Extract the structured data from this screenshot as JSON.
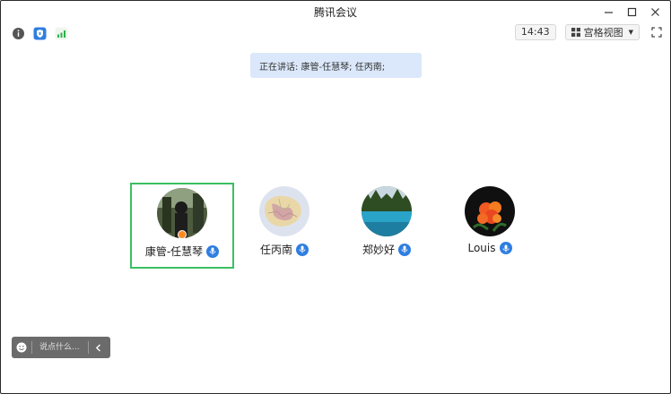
{
  "window": {
    "title": "腾讯会议"
  },
  "toolbar": {
    "time": "14:43",
    "view_label": "宫格视图"
  },
  "speaking": {
    "text": "正在讲话: 康管-任慧琴; 任丙南;"
  },
  "participants": [
    {
      "name": "康管-任慧琴",
      "is_host": true,
      "mic": "on",
      "selected": true
    },
    {
      "name": "任丙南",
      "mic": "on"
    },
    {
      "name": "郑妙好",
      "mic": "speaking"
    },
    {
      "name": "Louis",
      "mic": "speaking"
    }
  ],
  "chat": {
    "placeholder": "说点什么..."
  },
  "colors": {
    "accent": "#2f7ee0",
    "speaking_banner": "#dbe8fb",
    "active_border": "#3bbf62",
    "host_badge": "#ff8a22"
  }
}
